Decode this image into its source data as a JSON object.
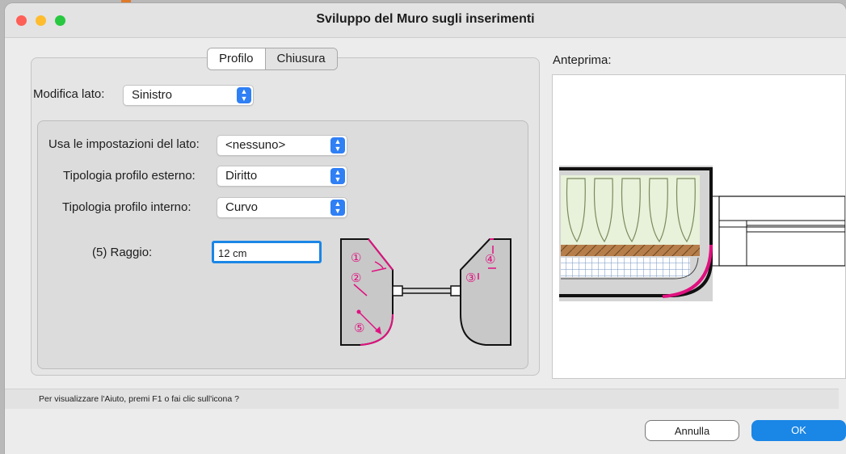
{
  "window": {
    "title": "Sviluppo del Muro sugli inserimenti"
  },
  "tabs": [
    {
      "label": "Profilo"
    },
    {
      "label": "Chiusura"
    }
  ],
  "edit_side": {
    "label": "Modifica lato:",
    "value": "Sinistro"
  },
  "use_side_settings": {
    "label": "Usa le impostazioni del lato:",
    "value": "<nessuno>"
  },
  "outer_profile": {
    "label": "Tipologia profilo esterno:",
    "value": "Diritto"
  },
  "inner_profile": {
    "label": "Tipologia profilo interno:",
    "value": "Curvo"
  },
  "radius": {
    "label": "(5) Raggio:",
    "value": "12 cm"
  },
  "diagram_markers": [
    "①",
    "②",
    "③",
    "④",
    "⑤"
  ],
  "preview": {
    "label": "Anteprima:"
  },
  "status": {
    "text": "Per visualizzare l'Aiuto, premi F1 o fai clic sull'icona ?"
  },
  "buttons": {
    "cancel": "Annulla",
    "ok": "OK"
  },
  "colors": {
    "accent": "#1a86e6",
    "highlight": "#e0117f",
    "insulation": "#e8f1d9",
    "wood": "#b67e4a",
    "grid": "#b7cde5"
  }
}
